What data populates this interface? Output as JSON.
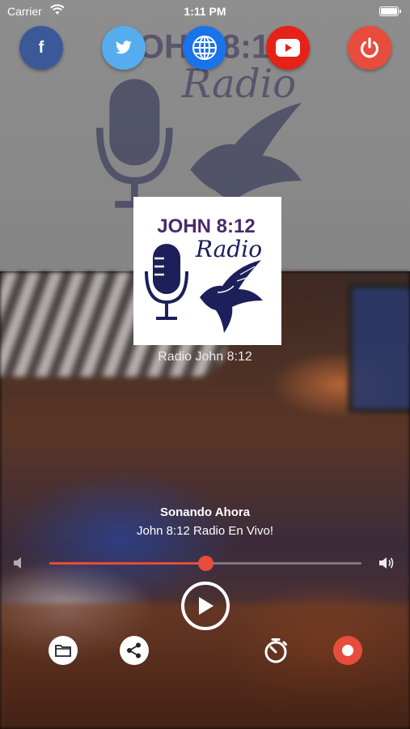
{
  "status_bar": {
    "carrier": "Carrier",
    "time": "1:11 PM",
    "battery_level": 1.0
  },
  "social": [
    {
      "name": "facebook",
      "icon": "facebook-icon",
      "color": "#3b5998",
      "glyph": "f"
    },
    {
      "name": "twitter",
      "icon": "twitter-icon",
      "color": "#55acee"
    },
    {
      "name": "website",
      "icon": "globe-icon",
      "color": "#1a73e8"
    },
    {
      "name": "youtube",
      "icon": "youtube-icon",
      "color": "#e62117"
    },
    {
      "name": "power",
      "icon": "power-icon",
      "color": "#e74c3c"
    }
  ],
  "logo": {
    "line1": "JOHN 8:12",
    "line2": "Radio",
    "colors": {
      "title": "#4a2a6a",
      "ink": "#1c1f5a"
    }
  },
  "station": {
    "name": "Radio John 8:12"
  },
  "now_playing": {
    "label": "Sonando Ahora",
    "title": "John 8:12 Radio En Vivo!"
  },
  "volume": {
    "level": 0.5,
    "accent": "#e74c3c"
  },
  "controls": {
    "play_icon": "play-icon",
    "tools": [
      "folder-icon",
      "share-icon",
      "timer-icon",
      "record-icon"
    ]
  }
}
